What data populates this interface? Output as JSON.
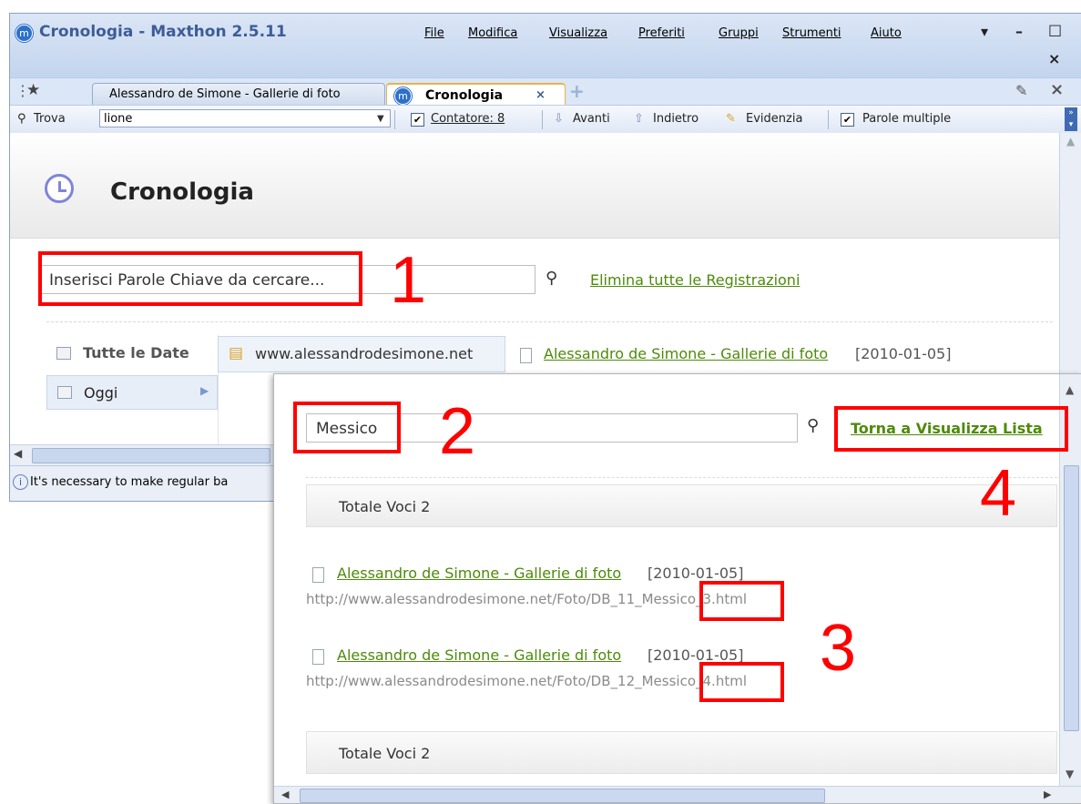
{
  "window": {
    "title": "Cronologia - Maxthon 2.5.11",
    "menu": [
      "File",
      "Modifica",
      "Visualizza",
      "Preferiti",
      "Gruppi",
      "Strumenti",
      "Aiuto"
    ],
    "controls": {
      "dropdown": "▾",
      "minimize": "–",
      "maximize": "□",
      "close": "×"
    }
  },
  "tabs": {
    "star": "★",
    "items": [
      {
        "label": "Alessandro de Simone - Gallerie di foto",
        "active": false
      },
      {
        "label": "Cronologia",
        "active": true,
        "close": "×"
      }
    ],
    "new_tab": "+",
    "right_close": "×"
  },
  "findbar": {
    "label": "Trova",
    "value": "lione",
    "counter": "Contatore: 8",
    "next": "Avanti",
    "prev": "Indietro",
    "highlight": "Evidenzia",
    "multiple": "Parole multiple"
  },
  "history": {
    "title": "Cronologia",
    "search_placeholder": "Inserisci Parole Chiave da cercare...",
    "delete_all": "Elimina tutte le Registrazioni",
    "all_dates": "Tutte le Date",
    "today": "Oggi",
    "folder": "www.alessandrodesimone.net",
    "entry_title": "Alessandro de Simone - Gallerie di foto",
    "entry_date": "[2010-01-05]"
  },
  "status": {
    "text": "It's necessary to make regular ba"
  },
  "overlay": {
    "search_value": "Messico",
    "back_link": "Torna a Visualizza Lista",
    "total_label": "Totale Voci 2",
    "results": [
      {
        "title": "Alessandro de Simone - Gallerie di foto",
        "date": "[2010-01-05]",
        "url_pre": "http://www.alessandrodesimone.net/Foto/DB_11_",
        "url_hit": "Messico",
        "url_post": "_3.html"
      },
      {
        "title": "Alessandro de Simone - Gallerie di foto",
        "date": "[2010-01-05]",
        "url_pre": "http://www.alessandrodesimone.net/Foto/DB_12_",
        "url_hit": "Messico",
        "url_post": "_4.html"
      }
    ],
    "total_label_2": "Totale Voci 2"
  },
  "annotations": {
    "n1": "1",
    "n2": "2",
    "n3": "3",
    "n4": "4"
  },
  "colors": {
    "accent": "#3d5d96",
    "link": "#4d8a0a",
    "annotation": "#ff0000"
  }
}
